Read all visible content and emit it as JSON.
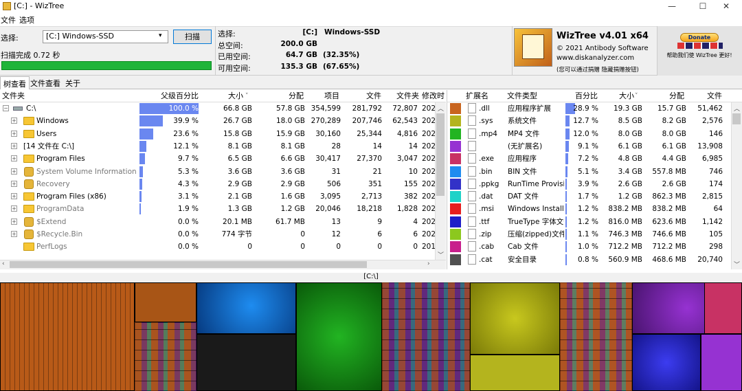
{
  "window": {
    "app_icon": "wiztree-icon",
    "title": "[C:]  - WizTree",
    "minimize": "—",
    "maximize": "☐",
    "close": "✕"
  },
  "menu": {
    "file": "文件",
    "options": "选项"
  },
  "scan": {
    "select_label": "选择:",
    "drive": "[C:] Windows-SSD",
    "scan_button": "扫描",
    "status": "扫描完成 0.72 秒",
    "progress": 1.0
  },
  "info": {
    "select_label": "选择:",
    "drive_letter": "[C:]",
    "drive_name": "Windows-SSD",
    "total_label": "总空间:",
    "total": "200.0 GB",
    "used_label": "已用空间:",
    "used": "64.7 GB",
    "used_pct": "(32.35%)",
    "free_label": "可用空间:",
    "free": "135.3 GB",
    "free_pct": "(67.65%)"
  },
  "about": {
    "name": "WizTree v4.01 x64",
    "copyright": "© 2021 Antibody Software",
    "site": "www.diskanalyzer.com",
    "note": "(您可以通过捐赠 隐藏捐赠按钮)"
  },
  "donate": {
    "button": "Donate",
    "caption": "帮助我们使 WizTree 更好!"
  },
  "tabs": [
    "树查看",
    "文件查看",
    "关于"
  ],
  "tree": {
    "columns": [
      "文件夹",
      "父级百分比",
      "大小",
      "分配",
      "项目",
      "文件",
      "文件夹",
      "修改时"
    ],
    "sort_indicator": "˅",
    "rows": [
      {
        "name": "C:\\",
        "pct": "100.0 %",
        "pct_value": 100.0,
        "size": "66.8 GB",
        "alloc": "57.8 GB",
        "items": "354,599",
        "files": "281,792",
        "folders": "72,807",
        "mod": "202",
        "icon": "drive-icon",
        "expander": "⊟",
        "gray": false
      },
      {
        "name": "Windows",
        "pct": "39.9 %",
        "pct_value": 39.9,
        "size": "26.7 GB",
        "alloc": "18.0 GB",
        "items": "270,289",
        "files": "207,746",
        "folders": "62,543",
        "mod": "202",
        "icon": "folder-icon",
        "expander": "⊞",
        "gray": false
      },
      {
        "name": "Users",
        "pct": "23.6 %",
        "pct_value": 23.6,
        "size": "15.8 GB",
        "alloc": "15.9 GB",
        "items": "30,160",
        "files": "25,344",
        "folders": "4,816",
        "mod": "202",
        "icon": "folder-icon",
        "expander": "⊞",
        "gray": false
      },
      {
        "name": "[14 文件在 C:\\]",
        "pct": "12.1 %",
        "pct_value": 12.1,
        "size": "8.1 GB",
        "alloc": "8.1 GB",
        "items": "28",
        "files": "14",
        "folders": "14",
        "mod": "202",
        "icon": "",
        "expander": "⊞",
        "gray": false
      },
      {
        "name": "Program Files",
        "pct": "9.7 %",
        "pct_value": 9.7,
        "size": "6.5 GB",
        "alloc": "6.6 GB",
        "items": "30,417",
        "files": "27,370",
        "folders": "3,047",
        "mod": "202",
        "icon": "folder-icon",
        "expander": "⊞",
        "gray": false
      },
      {
        "name": "System Volume Information",
        "pct": "5.3 %",
        "pct_value": 5.3,
        "size": "3.6 GB",
        "alloc": "3.6 GB",
        "items": "31",
        "files": "21",
        "folders": "10",
        "mod": "202",
        "icon": "system-folder-icon",
        "expander": "⊞",
        "gray": true
      },
      {
        "name": "Recovery",
        "pct": "4.3 %",
        "pct_value": 4.3,
        "size": "2.9 GB",
        "alloc": "2.9 GB",
        "items": "506",
        "files": "351",
        "folders": "155",
        "mod": "202",
        "icon": "system-folder-icon",
        "expander": "⊞",
        "gray": true
      },
      {
        "name": "Program Files (x86)",
        "pct": "3.1 %",
        "pct_value": 3.1,
        "size": "2.1 GB",
        "alloc": "1.6 GB",
        "items": "3,095",
        "files": "2,713",
        "folders": "382",
        "mod": "202",
        "icon": "folder-icon",
        "expander": "⊞",
        "gray": false
      },
      {
        "name": "ProgramData",
        "pct": "1.9 %",
        "pct_value": 1.9,
        "size": "1.3 GB",
        "alloc": "1.2 GB",
        "items": "20,046",
        "files": "18,218",
        "folders": "1,828",
        "mod": "202",
        "icon": "folder-icon",
        "expander": "⊞",
        "gray": true
      },
      {
        "name": "$Extend",
        "pct": "0.0 %",
        "pct_value": 0.0,
        "size": "20.1 MB",
        "alloc": "61.7 MB",
        "items": "13",
        "files": "9",
        "folders": "4",
        "mod": "202",
        "icon": "system-folder-icon",
        "expander": "⊞",
        "gray": true
      },
      {
        "name": "$Recycle.Bin",
        "pct": "0.0 %",
        "pct_value": 0.0,
        "size": "774 字节",
        "alloc": "0",
        "items": "12",
        "files": "6",
        "folders": "6",
        "mod": "202",
        "icon": "system-folder-icon",
        "expander": "⊞",
        "gray": true
      },
      {
        "name": "PerfLogs",
        "pct": "0.0 %",
        "pct_value": 0.0,
        "size": "0",
        "alloc": "0",
        "items": "0",
        "files": "0",
        "folders": "0",
        "mod": "201",
        "icon": "folder-icon",
        "expander": "",
        "gray": true
      }
    ]
  },
  "ext": {
    "columns": [
      "扩展名",
      "文件类型",
      "百分比",
      "大小",
      "分配",
      "文件"
    ],
    "sort_indicator": "˅",
    "rows": [
      {
        "ext": ".dll",
        "type": "应用程序扩展",
        "pct": "28.9 %",
        "pct_value": 28.9,
        "size": "19.3 GB",
        "alloc": "15.7 GB",
        "files": "51,462",
        "color": "#c8641e"
      },
      {
        "ext": ".sys",
        "type": "系统文件",
        "pct": "12.7 %",
        "pct_value": 12.7,
        "size": "8.5 GB",
        "alloc": "8.2 GB",
        "files": "2,576",
        "color": "#b4b41e"
      },
      {
        "ext": ".mp4",
        "type": "MP4 文件",
        "pct": "12.0 %",
        "pct_value": 12.0,
        "size": "8.0 GB",
        "alloc": "8.0 GB",
        "files": "146",
        "color": "#22b422"
      },
      {
        "ext": "",
        "type": "(无扩展名)",
        "pct": "9.1 %",
        "pct_value": 9.1,
        "size": "6.1 GB",
        "alloc": "6.1 GB",
        "files": "13,908",
        "color": "#9632d2"
      },
      {
        "ext": ".exe",
        "type": "应用程序",
        "pct": "7.2 %",
        "pct_value": 7.2,
        "size": "4.8 GB",
        "alloc": "4.4 GB",
        "files": "6,985",
        "color": "#c83264"
      },
      {
        "ext": ".bin",
        "type": "BIN 文件",
        "pct": "5.1 %",
        "pct_value": 5.1,
        "size": "3.4 GB",
        "alloc": "557.8 MB",
        "files": "746",
        "color": "#1e8cf0"
      },
      {
        "ext": ".ppkg",
        "type": "RunTime Provisio",
        "pct": "3.9 %",
        "pct_value": 3.9,
        "size": "2.6 GB",
        "alloc": "2.6 GB",
        "files": "174",
        "color": "#3232c8"
      },
      {
        "ext": ".dat",
        "type": "DAT 文件",
        "pct": "1.7 %",
        "pct_value": 1.7,
        "size": "1.2 GB",
        "alloc": "862.3 MB",
        "files": "2,815",
        "color": "#1ed2c8"
      },
      {
        "ext": ".msi",
        "type": "Windows Installer",
        "pct": "1.2 %",
        "pct_value": 1.2,
        "size": "838.2 MB",
        "alloc": "838.2 MB",
        "files": "64",
        "color": "#e61e1e"
      },
      {
        "ext": ".ttf",
        "type": "TrueType 字体文件",
        "pct": "1.2 %",
        "pct_value": 1.2,
        "size": "816.0 MB",
        "alloc": "623.6 MB",
        "files": "1,142",
        "color": "#1e1ec8"
      },
      {
        "ext": ".zip",
        "type": "压缩(zipped)文件",
        "pct": "1.1 %",
        "pct_value": 1.1,
        "size": "746.3 MB",
        "alloc": "746.6 MB",
        "files": "105",
        "color": "#8cc81e"
      },
      {
        "ext": ".cab",
        "type": "Cab 文件",
        "pct": "1.0 %",
        "pct_value": 1.0,
        "size": "712.2 MB",
        "alloc": "712.2 MB",
        "files": "298",
        "color": "#c81e8c"
      },
      {
        "ext": ".cat",
        "type": "安全目录",
        "pct": "0.8 %",
        "pct_value": 0.8,
        "size": "560.9 MB",
        "alloc": "468.6 MB",
        "files": "20,740",
        "color": "#505050"
      }
    ]
  },
  "treemap": {
    "label": "[C:\\]"
  }
}
